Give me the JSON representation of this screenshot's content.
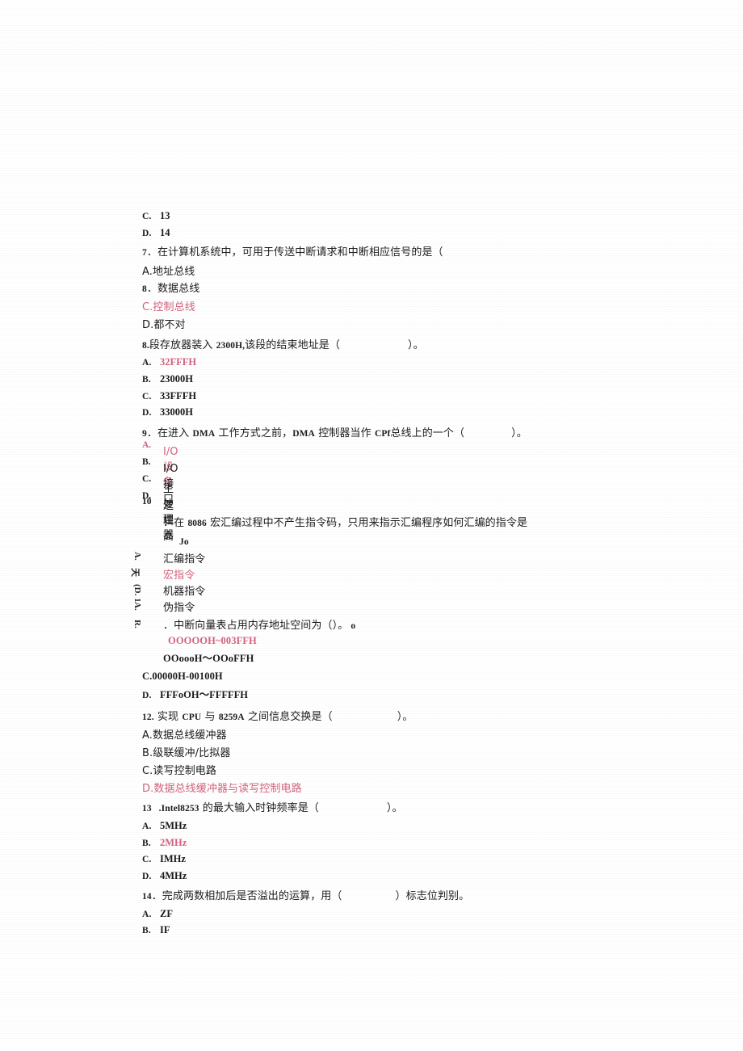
{
  "document": {
    "type": "scanned-exam-page",
    "language": "zh-CN",
    "accent_red": "#d4627e",
    "text_color": "#1c1c1c",
    "page_background": "#ffffff"
  },
  "blocks": [
    {
      "id": "q6-tail",
      "kind": "orphan-options",
      "options": [
        {
          "label": "C.",
          "text": "13",
          "red": false
        },
        {
          "label": "D.",
          "text": "14",
          "red": false
        }
      ]
    },
    {
      "id": "q7",
      "kind": "question",
      "number": "7",
      "stem": ".在计算机系统中，可用于传送中断请求和中断相应信号的是（",
      "options": [
        {
          "label": "A.",
          "text": "地址总线",
          "red": false
        },
        {
          "label": "8",
          "text": ".数据总线",
          "red": false
        },
        {
          "label": "C.",
          "text": "控制总线",
          "red": true
        },
        {
          "label": "D.",
          "text": "都不对",
          "red": false
        }
      ]
    },
    {
      "id": "q8",
      "kind": "question",
      "number": "8.",
      "stem_parts": [
        "段存放器装入 ",
        "2300H,",
        "该段的结束地址是（",
        "　　　　　）。"
      ],
      "stem": "段存放器装入 2300H,该段的结束地址是（　　　　　）。",
      "options": [
        {
          "label": "A.",
          "text": "32FFFH",
          "red": true
        },
        {
          "label": "B.",
          "text": "23000H",
          "red": false
        },
        {
          "label": "C.",
          "text": "33FFFH",
          "red": false
        },
        {
          "label": "D.",
          "text": "33000H",
          "red": false
        }
      ]
    },
    {
      "id": "q9",
      "kind": "question",
      "number": "9",
      "stem": "．在进入 DMA 工作方式之前，DMA 控制器当作 CPf 总线上的一个（　　　）。",
      "options": [
        {
          "label": "A.",
          "text": "I/O 设备",
          "red": true
        },
        {
          "label": "B.",
          "text": "I/O 接口",
          "red": false
        },
        {
          "label": "C.",
          "text": "主处理器",
          "red": false
        },
        {
          "label": "D.",
          "text": "逻辑高",
          "red": false
        }
      ]
    },
    {
      "id": "q10",
      "kind": "question",
      "number": "10",
      "stem": "．在 8086 宏汇编过程中不产生指令码，只用来指示汇编程序如何汇编的指令是",
      "artifact": "Jo",
      "rotated_labels": [
        "A.",
        "天",
        "(D. 1",
        "A.",
        "R."
      ],
      "options": [
        {
          "label": "A.",
          "text": "汇编指令",
          "red": false
        },
        {
          "label": "B.",
          "text": "宏指令",
          "red": true
        },
        {
          "label": "C.",
          "text": "机器指令",
          "red": false
        },
        {
          "label": "D.",
          "text": "伪指令",
          "red": false
        }
      ]
    },
    {
      "id": "q11",
      "kind": "question",
      "number": "11",
      "stem": "．中断向量表占用内存地址空间为（）。",
      "options": [
        {
          "label": "A.",
          "text": "OOOOOH~003FFH",
          "red": true
        },
        {
          "label": "B.",
          "text": "OOoooH〜OOoFFH",
          "red": false
        },
        {
          "label": "C.",
          "text": "00000H-00100H",
          "red": false
        },
        {
          "label": "D.",
          "text": "FFFoOH〜FFFFFH",
          "red": false
        }
      ]
    },
    {
      "id": "q12",
      "kind": "question",
      "number": "12.",
      "stem": "实现 CPU 与 8259A 之间信息交换是（　　　　　）。",
      "options": [
        {
          "label": "A.",
          "text": "数据总线缓冲器",
          "red": false
        },
        {
          "label": "B.",
          "text": "级联缓冲/比拟器",
          "red": false
        },
        {
          "label": "C.",
          "text": "读写控制电路",
          "red": false
        },
        {
          "label": "D.",
          "text": "数据总线缓冲器与读写控制电路",
          "red": true
        }
      ]
    },
    {
      "id": "q13",
      "kind": "question",
      "number": "13",
      "stem": ".Intel8253 的最大输入时钟频率是（　　　　　）。",
      "options": [
        {
          "label": "A.",
          "text": "5MHz",
          "red": false
        },
        {
          "label": "B.",
          "text": "2MHz",
          "red": true
        },
        {
          "label": "C.",
          "text": "IMHz",
          "red": false
        },
        {
          "label": "D.",
          "text": "4MHz",
          "red": false
        }
      ]
    },
    {
      "id": "q14",
      "kind": "question",
      "number": "14",
      "stem": "．完成两数相加后是否溢出的运算，用（　　　　）标志位判别。",
      "options": [
        {
          "label": "A.",
          "text": "ZF",
          "red": false
        },
        {
          "label": "B.",
          "text": "IF",
          "red": false
        }
      ]
    }
  ],
  "lines": {
    "l01_lbl": "C.",
    "l01_txt": "13",
    "l02_lbl": "D.",
    "l02_txt": "14",
    "l03_num": "7",
    "l03_stem": "．在计算机系统中，可用于传送中断请求和中断相应信号的是（",
    "l04": "A.地址总线",
    "l05_lbl": "8",
    "l05_txt": "．数据总线",
    "l06": "C.控制总线",
    "l07": "D.都不对",
    "l08_num": "8.",
    "l08_a": "段存放器装入 ",
    "l08_b": "2300H,",
    "l08_c": "该段的结束地址是（",
    "l08_d": "）。",
    "l09_lbl": "A.",
    "l09_txt": "32FFFH",
    "l10_lbl": "B.",
    "l10_txt": "23000H",
    "l11_lbl": "C.",
    "l11_txt": "33FFFH",
    "l12_lbl": "D.",
    "l12_txt": "33000H",
    "l13_num": "9",
    "l13_a": "．在进入 ",
    "l13_b": "DMA",
    "l13_c": " 工作方式之前，",
    "l13_d": "DMA",
    "l13_e": " 控制器当作 ",
    "l13_f": "CPf",
    "l13_g": "总线上的一个（",
    "l13_h": "）。",
    "l14_lbl": "A.",
    "l14_txt": "I/O 设备",
    "l15_lbl": "B.",
    "l15_txt": "I/O 接口",
    "l16_lbl": "C.",
    "l16_txt": "主处理器",
    "l17_lbl": "D.",
    "l17_txt": "逻辑高",
    "l18_num": "10",
    "l18_a": "．在 ",
    "l18_b": "8086",
    "l18_c": " 宏汇编过程中不产生指令码，只用来指示汇编程序如何汇编的指令是",
    "l19_artifact": "Jo",
    "l20": "汇编指令",
    "l21": "宏指令",
    "l22": "机器指令",
    "l23": "伪指令",
    "l24": "．中断向量表占用内存地址空间为（）。",
    "l24_tail": "o",
    "l25": "OOOOOH~003FFH",
    "l26": "OOoooH〜OOoFFH",
    "l27": "C.00000H-00100H",
    "l28_lbl": "D.",
    "l28_txt": "FFFoOH〜FFFFFH",
    "l29_num": "12.",
    "l29_a": " 实现 ",
    "l29_b": "CPU",
    "l29_c": " 与 ",
    "l29_d": "8259A",
    "l29_e": " 之间信息交换是（",
    "l29_f": "）。",
    "l30": "A.数据总线缓冲器",
    "l31": "B.级联缓冲/比拟器",
    "l32": "C.读写控制电路",
    "l33": "D.数据总线缓冲器与读写控制电路",
    "l34_num": "13",
    "l34_a": " .Intel8253",
    "l34_b": " 的最大输入时钟频率是（",
    "l34_c": "）。",
    "l35_lbl": "A.",
    "l35_txt": "5MHz",
    "l36_lbl": "B.",
    "l36_txt": "2MHz",
    "l37_lbl": "C.",
    "l37_txt": "IMHz",
    "l38_lbl": "D.",
    "l38_txt": "4MHz",
    "l39_num": "14",
    "l39_a": "．完成两数相加后是否溢出的运算，用（",
    "l39_b": "）标志位判别。",
    "l40_lbl": "A.",
    "l40_txt": "ZF",
    "l41_lbl": "B.",
    "l41_txt": "IF",
    "rot1": "A.",
    "rot2": "天",
    "rot3": "(D. 1",
    "rot4": "A.",
    "rot5": "R."
  }
}
